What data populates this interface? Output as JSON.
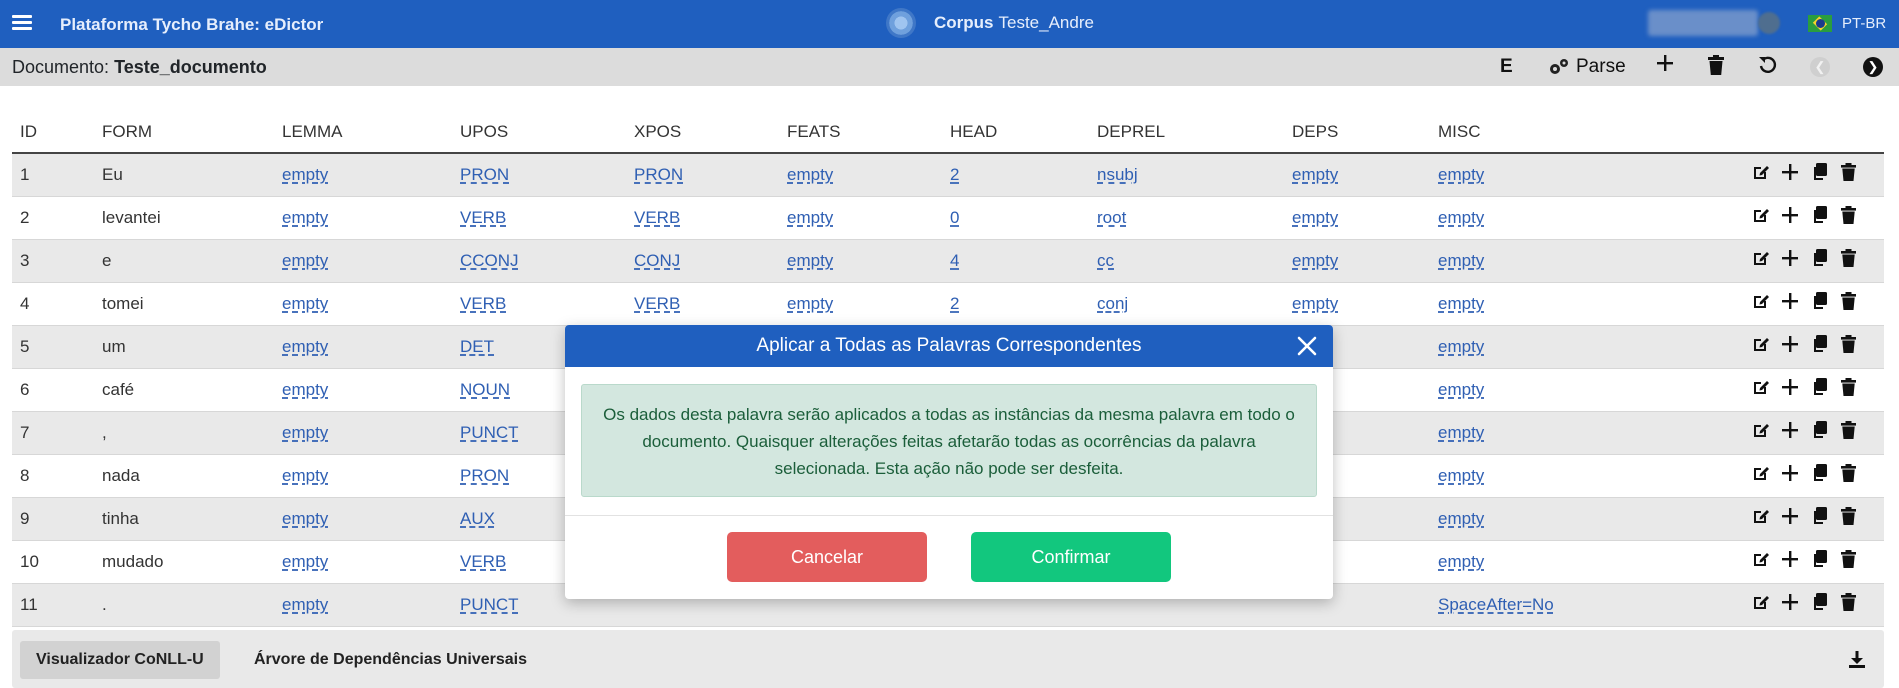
{
  "app": {
    "title": "Plataforma Tycho Brahe: eDictor",
    "corpus_label": "Corpus",
    "corpus_name": "Teste_Andre",
    "language": "PT-BR"
  },
  "document": {
    "label": "Documento:",
    "name": "Teste_documento",
    "toolbar": {
      "edit_glyph": "E",
      "parse_label": "Parse"
    }
  },
  "table": {
    "columns": [
      "ID",
      "FORM",
      "LEMMA",
      "UPOS",
      "XPOS",
      "FEATS",
      "HEAD",
      "DEPREL",
      "DEPS",
      "MISC"
    ],
    "rows": [
      {
        "id": "1",
        "form": "Eu",
        "lemma": "empty",
        "upos": "PRON",
        "xpos": "PRON",
        "feats": "empty",
        "head": "2",
        "deprel": "nsubj",
        "deps": "empty",
        "misc": "empty"
      },
      {
        "id": "2",
        "form": "levantei",
        "lemma": "empty",
        "upos": "VERB",
        "xpos": "VERB",
        "feats": "empty",
        "head": "0",
        "deprel": "root",
        "deps": "empty",
        "misc": "empty"
      },
      {
        "id": "3",
        "form": "e",
        "lemma": "empty",
        "upos": "CCONJ",
        "xpos": "CONJ",
        "feats": "empty",
        "head": "4",
        "deprel": "cc",
        "deps": "empty",
        "misc": "empty"
      },
      {
        "id": "4",
        "form": "tomei",
        "lemma": "empty",
        "upos": "VERB",
        "xpos": "VERB",
        "feats": "empty",
        "head": "2",
        "deprel": "conj",
        "deps": "empty",
        "misc": "empty"
      },
      {
        "id": "5",
        "form": "um",
        "lemma": "empty",
        "upos": "DET",
        "xpos": "",
        "feats": "",
        "head": "",
        "deprel": "",
        "deps": "",
        "misc": "empty"
      },
      {
        "id": "6",
        "form": "café",
        "lemma": "empty",
        "upos": "NOUN",
        "xpos": "",
        "feats": "",
        "head": "",
        "deprel": "",
        "deps": "",
        "misc": "empty"
      },
      {
        "id": "7",
        "form": ",",
        "lemma": "empty",
        "upos": "PUNCT",
        "xpos": "",
        "feats": "",
        "head": "",
        "deprel": "",
        "deps": "",
        "misc": "empty"
      },
      {
        "id": "8",
        "form": "nada",
        "lemma": "empty",
        "upos": "PRON",
        "xpos": "",
        "feats": "",
        "head": "",
        "deprel": "",
        "deps": "",
        "misc": "empty"
      },
      {
        "id": "9",
        "form": "tinha",
        "lemma": "empty",
        "upos": "AUX",
        "xpos": "",
        "feats": "",
        "head": "",
        "deprel": "",
        "deps": "",
        "misc": "empty"
      },
      {
        "id": "10",
        "form": "mudado",
        "lemma": "empty",
        "upos": "VERB",
        "xpos": "",
        "feats": "",
        "head": "",
        "deprel": "",
        "deps": "",
        "misc": "empty"
      },
      {
        "id": "11",
        "form": ".",
        "lemma": "empty",
        "upos": "PUNCT",
        "xpos": "",
        "feats": "",
        "head": "",
        "deprel": "",
        "deps": "",
        "misc": "SpaceAfter=No"
      }
    ]
  },
  "bottom_tabs": [
    {
      "label": "Visualizador CoNLL-U",
      "active": true
    },
    {
      "label": "Árvore de Dependências Universais",
      "active": false
    }
  ],
  "modal": {
    "title": "Aplicar a Todas as Palavras Correspondentes",
    "message": "Os dados desta palavra serão aplicados a todas as instâncias da mesma palavra em todo o documento. Quaisquer alterações feitas afetarão todas as ocorrências da palavra selecionada. Esta ação não pode ser desfeita.",
    "cancel_label": "Cancelar",
    "confirm_label": "Confirmar"
  },
  "colors": {
    "primary": "#1f5fbf",
    "danger": "#e35d5d",
    "success": "#12c77e",
    "link": "#2f5fb3",
    "alert_bg": "#d3e7df"
  }
}
